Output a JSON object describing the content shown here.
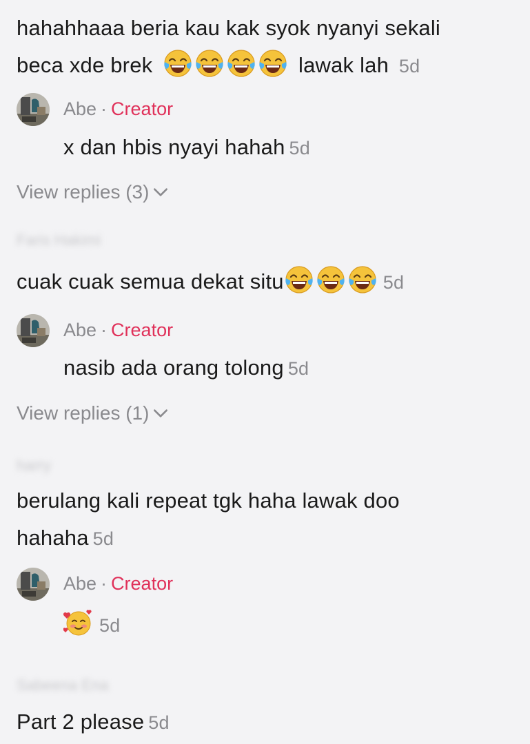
{
  "comments": [
    {
      "text_line1": "hahahhaaa beria kau kak syok nyanyi sekali",
      "text_line2_before": "beca xde brek",
      "emoji_count_label": "😂😂😂😂",
      "text_line2_after": "lawak lah",
      "time": "5d",
      "reply": {
        "name": "Abe",
        "dot": "·",
        "badge": "Creator",
        "text": "x dan hbis nyayi hahah",
        "time": "5d"
      },
      "view_replies": "View replies (3)"
    },
    {
      "author_blurred": "Faris Hakimi",
      "text_before": "cuak cuak semua dekat situ",
      "emoji_count_label": "😂😂😂",
      "time": "5d",
      "reply": {
        "name": "Abe",
        "dot": "·",
        "badge": "Creator",
        "text": "nasib ada orang tolong",
        "time": "5d"
      },
      "view_replies": "View replies (1)"
    },
    {
      "author_blurred": "harry",
      "text_line1": "berulang kali repeat tgk haha lawak doo",
      "text_line2": "hahaha",
      "time": "5d",
      "reply": {
        "name": "Abe",
        "dot": "·",
        "badge": "Creator",
        "emoji": "🥰",
        "time": "5d"
      }
    },
    {
      "author_blurred": "Sabeena Ena",
      "text": "Part 2 please",
      "time": "5d"
    }
  ],
  "icons": {
    "laugh": "tears-of-joy-emoji",
    "smile_hearts": "smiling-face-with-hearts-emoji",
    "chevron": "chevron-down-icon"
  },
  "colors": {
    "creator": "#e0315a",
    "muted": "#8a8a8e",
    "background": "#f3f3f5"
  }
}
